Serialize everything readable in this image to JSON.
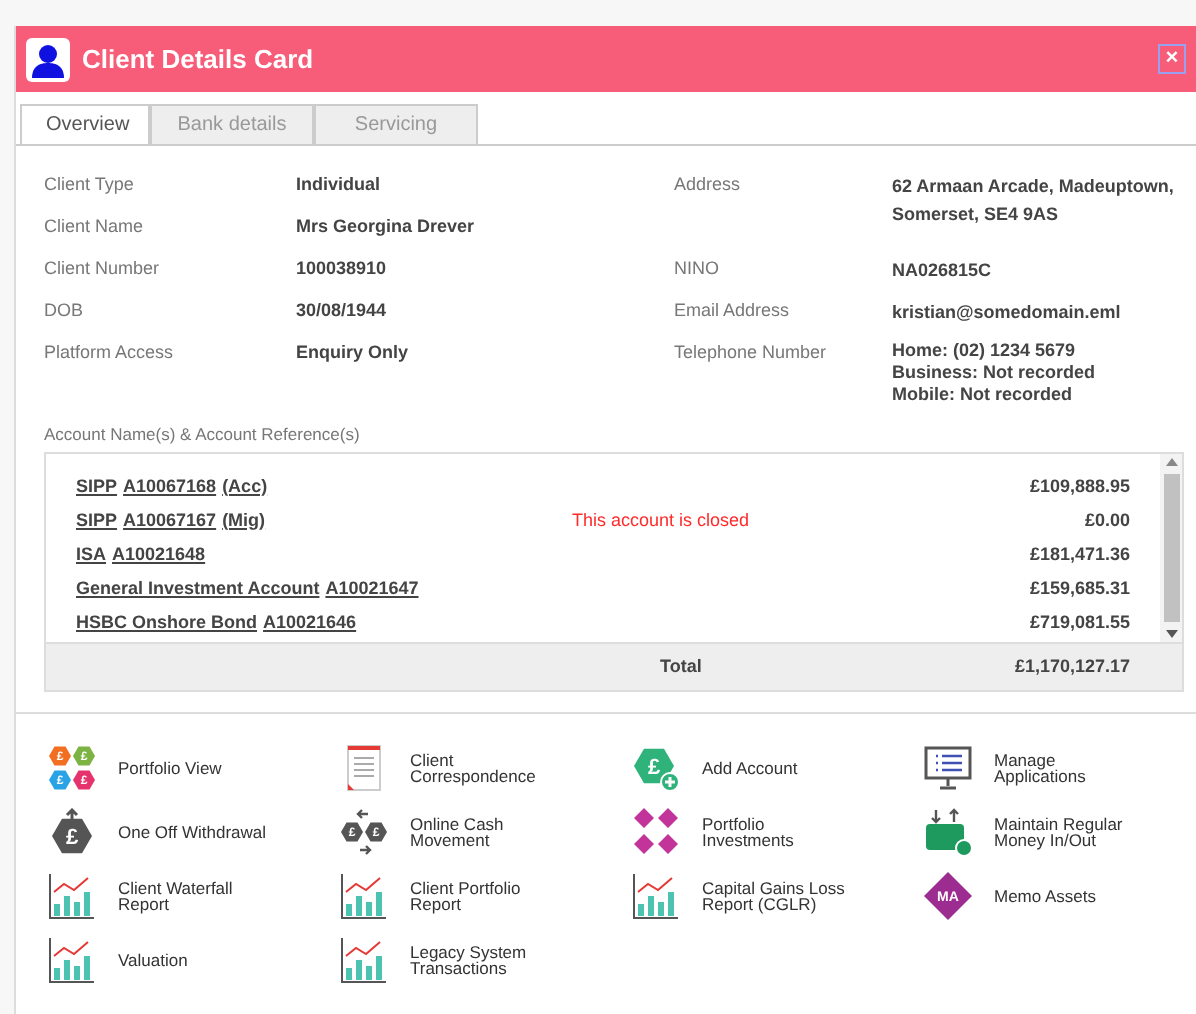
{
  "window": {
    "title": "Client Details Card",
    "close": "×"
  },
  "tabs": [
    {
      "label": "Overview",
      "selected": true
    },
    {
      "label": "Bank details",
      "selected": false
    },
    {
      "label": "Servicing",
      "selected": false
    }
  ],
  "details_left": [
    {
      "label": "Client Type",
      "value": "Individual"
    },
    {
      "label": "Client Name",
      "value": "Mrs Georgina Drever"
    },
    {
      "label": "Client Number",
      "value": "100038910"
    },
    {
      "label": "DOB",
      "value": "30/08/1944"
    },
    {
      "label": "Platform Access",
      "value": "Enquiry Only"
    }
  ],
  "details_right": [
    {
      "label": "Address",
      "lines": [
        "62 Armaan Arcade, Madeuptown,",
        "Somerset, SE4 9AS"
      ]
    },
    {
      "label": "NINO",
      "lines": [
        "NA026815C"
      ]
    },
    {
      "label": "Email Address",
      "lines": [
        "kristian@somedomain.eml"
      ]
    },
    {
      "label": "Telephone Number",
      "lines": [
        "Home: (02) 1234 5679",
        "Business: Not recorded",
        "Mobile: Not recorded"
      ]
    }
  ],
  "accounts": {
    "title": "Account Name(s) & Account Reference(s)",
    "rows": [
      {
        "name": "SIPP",
        "reference": "A10067168",
        "suffix": "(Acc)",
        "note": "",
        "amount": "£109,888.95"
      },
      {
        "name": "SIPP",
        "reference": "A10067167",
        "suffix": "(Mig)",
        "note": "This account is closed",
        "amount": "£0.00"
      },
      {
        "name": "ISA",
        "reference": "A10021648",
        "suffix": "",
        "note": "",
        "amount": "£181,471.36"
      },
      {
        "name": "General Investment Account",
        "reference": "A10021647",
        "suffix": "",
        "note": "",
        "amount": "£159,685.31"
      },
      {
        "name": "HSBC Onshore Bond",
        "reference": "A10021646",
        "suffix": "",
        "note": "",
        "amount": "£719,081.55"
      }
    ],
    "total_label": "Total",
    "total": "£1,170,127.17"
  },
  "actions": [
    {
      "label": "Portfolio View",
      "kind": "portfolio",
      "glyph": "£"
    },
    {
      "label": "Client Correspondence",
      "kind": "document"
    },
    {
      "label": "Add Account",
      "kind": "add",
      "glyph": "£"
    },
    {
      "label": "Manage Applications",
      "kind": "monitor"
    },
    {
      "label": "One Off Withdrawal",
      "kind": "withdraw",
      "glyph": "£"
    },
    {
      "label": "Online Cash Movement",
      "kind": "transfer",
      "glyph": "£"
    },
    {
      "label": "Portfolio Investments",
      "kind": "diamonds"
    },
    {
      "label": "Maintain Regular Money In/Out",
      "kind": "wallet"
    },
    {
      "label": "Client Waterfall Report",
      "kind": "chart"
    },
    {
      "label": "Client Portfolio Report",
      "kind": "chart"
    },
    {
      "label": "Capital Gains Loss Report (CGLR)",
      "kind": "chart"
    },
    {
      "label": "Memo Assets",
      "kind": "memo",
      "glyph": "MA"
    },
    {
      "label": "Valuation",
      "kind": "chart"
    },
    {
      "label": "Legacy System Transactions",
      "kind": "chart"
    }
  ]
}
